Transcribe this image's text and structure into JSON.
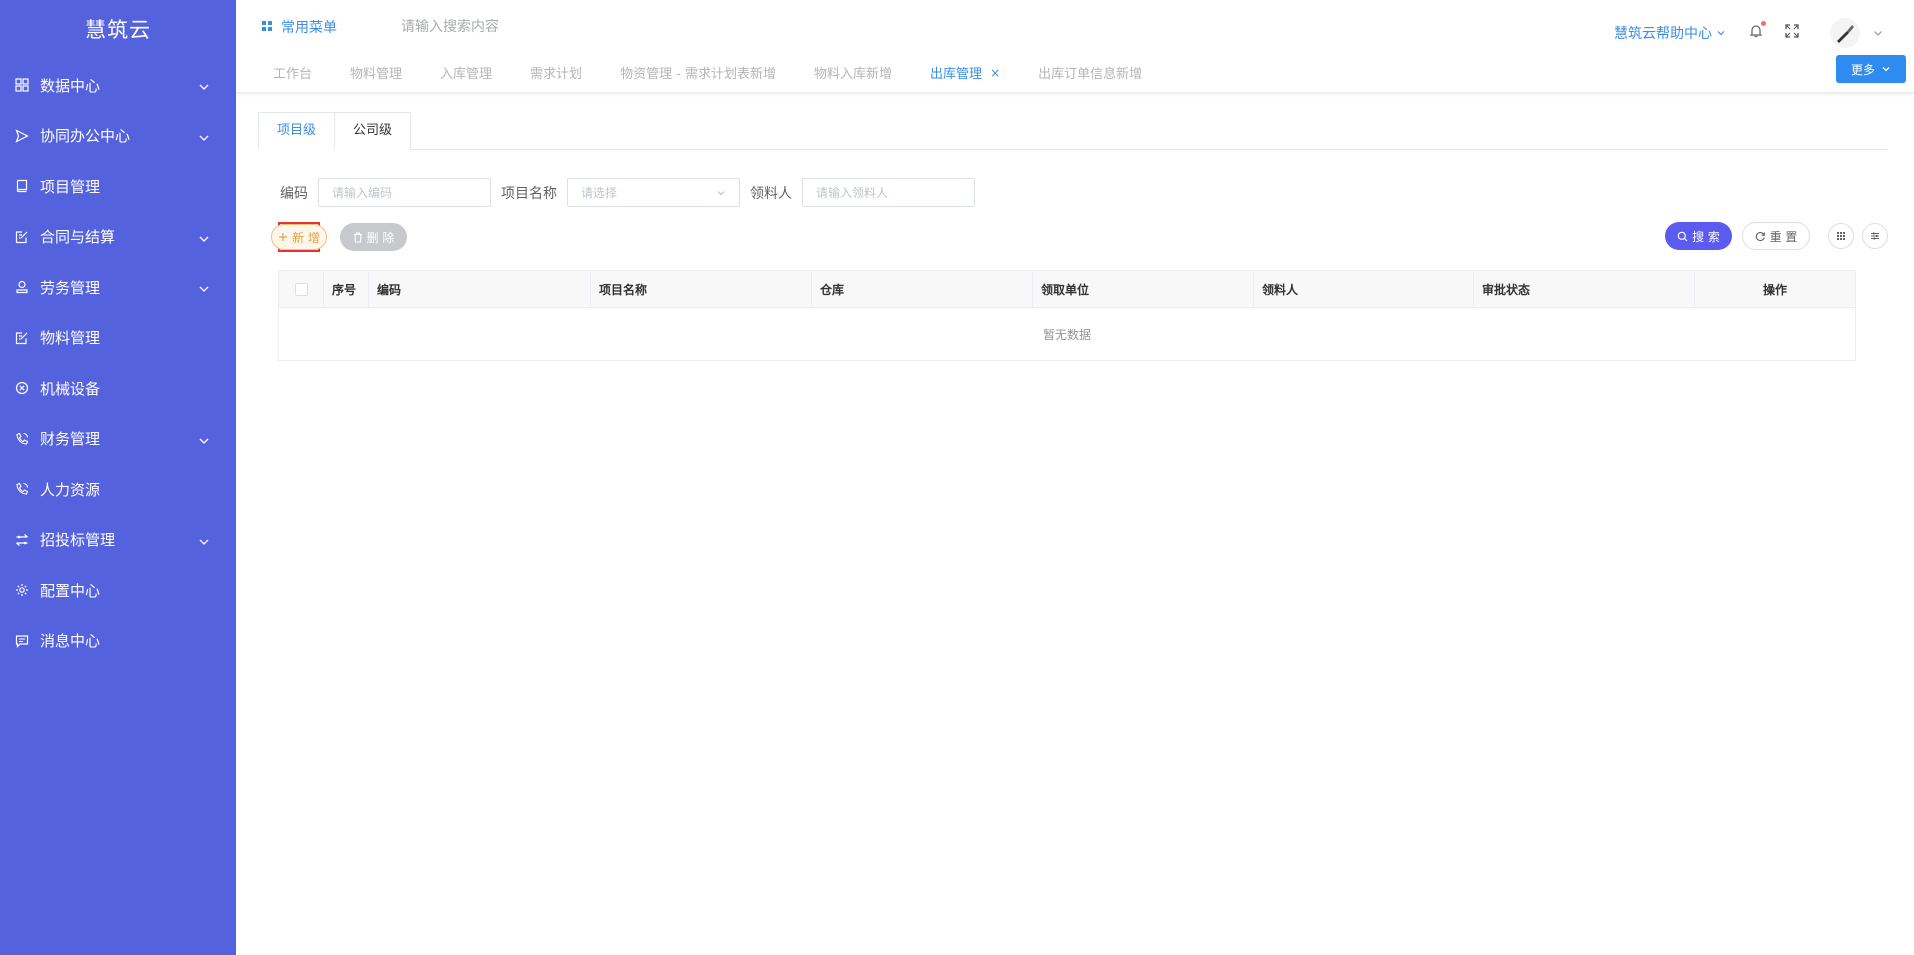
{
  "app": {
    "title": "慧筑云"
  },
  "sidebar": {
    "items": [
      {
        "label": "数据中心",
        "icon": "grid-icon",
        "expandable": true
      },
      {
        "label": "协同办公中心",
        "icon": "send-icon",
        "expandable": true
      },
      {
        "label": "项目管理",
        "icon": "book-icon",
        "expandable": false
      },
      {
        "label": "合同与结算",
        "icon": "edit-doc-icon",
        "expandable": true
      },
      {
        "label": "劳务管理",
        "icon": "user-stamp-icon",
        "expandable": true
      },
      {
        "label": "物料管理",
        "icon": "edit-doc-icon",
        "expandable": false
      },
      {
        "label": "机械设备",
        "icon": "circle-x-icon",
        "expandable": false
      },
      {
        "label": "财务管理",
        "icon": "phone-icon",
        "expandable": true
      },
      {
        "label": "人力资源",
        "icon": "phone-icon",
        "expandable": false
      },
      {
        "label": "招投标管理",
        "icon": "transfer-icon",
        "expandable": true
      },
      {
        "label": "配置中心",
        "icon": "gear-icon",
        "expandable": false
      },
      {
        "label": "消息中心",
        "icon": "message-icon",
        "expandable": false
      }
    ]
  },
  "topbar": {
    "fav_menu": "常用菜单",
    "search_placeholder": "请输入搜索内容",
    "help": "慧筑云帮助中心"
  },
  "tabs": {
    "items": [
      {
        "label": "工作台",
        "active": false
      },
      {
        "label": "物料管理",
        "active": false
      },
      {
        "label": "入库管理",
        "active": false
      },
      {
        "label": "需求计划",
        "active": false
      },
      {
        "label": "物资管理 - 需求计划表新增",
        "active": false
      },
      {
        "label": "物料入库新增",
        "active": false
      },
      {
        "label": "出库管理",
        "active": true
      },
      {
        "label": "出库订单信息新增",
        "active": false
      }
    ],
    "more": "更多"
  },
  "level_tabs": {
    "project": "项目级",
    "company": "公司级"
  },
  "filters": {
    "code_label": "编码",
    "code_placeholder": "请输入编码",
    "project_label": "项目名称",
    "project_placeholder": "请选择",
    "receiver_label": "领料人",
    "receiver_placeholder": "请输入领料人"
  },
  "actions": {
    "add": "新 增",
    "delete": "删 除",
    "search": "搜 索",
    "reset": "重 置"
  },
  "table": {
    "columns": [
      "序号",
      "编码",
      "项目名称",
      "仓库",
      "领取单位",
      "领料人",
      "审批状态",
      "操作"
    ],
    "empty": "暂无数据"
  },
  "colors": {
    "sidebar": "#5463dd",
    "accent": "#3a8ee6",
    "search": "#5b5bf0",
    "highlight": "#e63232"
  }
}
